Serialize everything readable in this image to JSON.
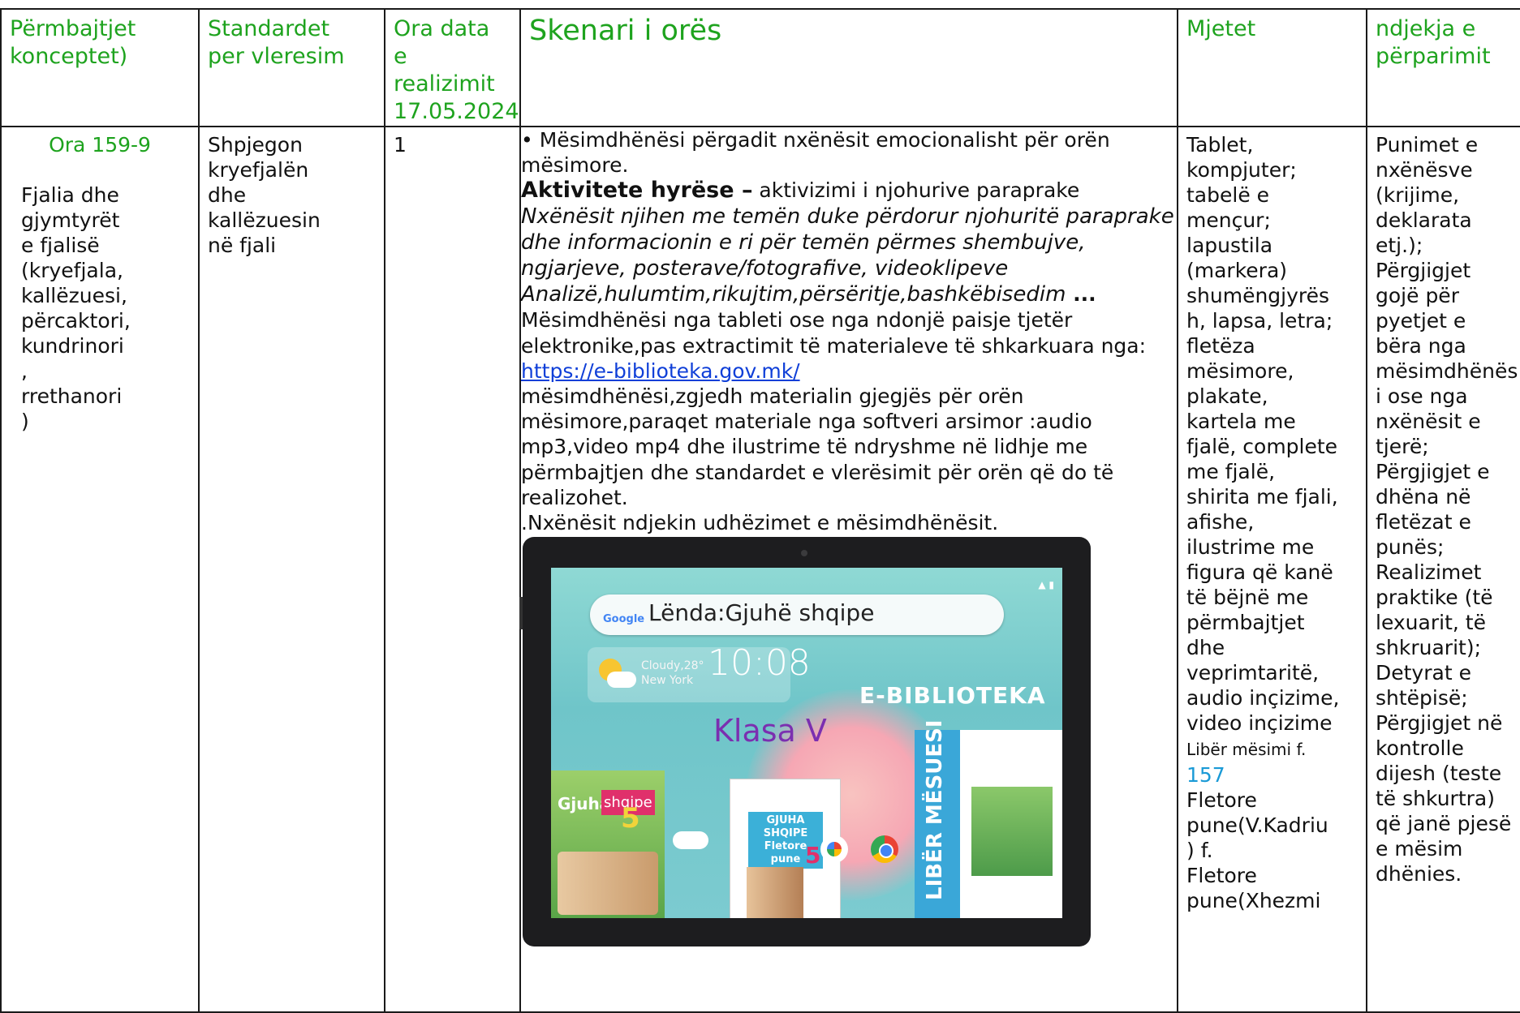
{
  "header": {
    "col1": [
      "Përmbajtjet",
      "konceptet)"
    ],
    "col2": [
      "Standardet",
      "per vleresim"
    ],
    "col3": [
      "Ora data e",
      "realizimit",
      "17.05.2024"
    ],
    "col4": "Skenari i orës",
    "col5": "Mjetet",
    "col6": [
      "ndjekja e",
      "përparimit"
    ]
  },
  "col1": {
    "topic": "Ora 159-9",
    "lines": [
      "Fjalia  dhe",
      "gjymtyrët",
      "e fjalisë",
      "(kryefjala,",
      "kallëzuesi,",
      "përcaktori,",
      "kundrinori",
      ",",
      "rrethanori",
      ")"
    ]
  },
  "col2": [
    "Shpjegon",
    "kryefjalën",
    "dhe",
    "kallëzuesin",
    "në fjali"
  ],
  "col3": "1",
  "col4": {
    "p1": "• Mësimdhënësi përgadit nxënësit emocionalisht për orën mësimore.",
    "bold": "Aktivitete hyrëse –",
    "after_bold": " aktivizimi i njohurive paraprake",
    "italic": "Nxënësit njihen me temën duke përdorur njohuritë paraprake dhe informacionin e ri për temën përmes shembujve, ngjarjeve, posterave/fotografive, videoklipeve Analizë,hulumtim,rikujtim,përsëritje,bashkëbisedim",
    "ellipsis": " ...",
    "p3": "Mësimdhënësi nga tableti ose nga ndonjë paisje tjetër elektronike,pas extractimit të materialeve të shkarkuara nga: ",
    "link": "https://e-biblioteka.gov.mk/",
    "p4": " mësimdhënësi,zgjedh materialin gjegjës për orën mësimore,paraqet materiale nga softveri arsimor :audio mp3,video mp4 dhe ilustrime të ndryshme në lidhje me përmbajtjen dhe standardet e vlerësimit për orën që do të realizohet.",
    "p5": ".Nxënësit ndjekin udhëzimet e mësimdhënësit."
  },
  "tablet": {
    "search_brand": "Google",
    "search_query": "Lënda:Gjuhë shqipe",
    "weather": [
      "Cloudy,28°",
      "New York"
    ],
    "clock": "10:08",
    "logo": "E-BIBLIOTEKA",
    "class_label": "Klasa V",
    "book1_a": "Gjuha",
    "book1_b": "shqipe",
    "book1_num": "5",
    "book2": "GJUHA SHQIPE Fletore pune",
    "book2_num": "5",
    "book3": "LIBËR MËSUESI"
  },
  "col5": {
    "lines": [
      "Tablet,",
      "kompjuter;",
      "tabelë e",
      "mençur;",
      "lapustila",
      "(markera)",
      "shumëngjyrës",
      "h, lapsa, letra;",
      "fletëza",
      "mësimore,",
      "plakate,",
      "kartela me",
      "fjalë, complete",
      "me fjalë,",
      "shirita me fjali,",
      "afishe,",
      "ilustrime me",
      "figura që kanë",
      "të bëjnë me",
      "përmbajtjet",
      "dhe",
      "veprimtaritë,",
      "audio inçizime,",
      "video inçizime"
    ],
    "small": "Libër mësimi f.",
    "page": "157",
    "lines2": [
      "Fletore",
      "pune(V.Kadriu",
      ") f.",
      "Fletore",
      "pune(Xhezmi"
    ]
  },
  "col6": [
    "Punimet e",
    "nxënësve",
    "(krijime,",
    "deklarata",
    "etj.);",
    "Përgjigjet",
    "gojë për",
    "pyetjet e",
    "bëra nga",
    "mësimdhënës",
    "i ose nga",
    "nxënësit e",
    "tjerë;",
    "Përgjigjet e",
    "dhëna në",
    "fletëzat e",
    "punës;",
    "Realizimet",
    "praktike (të",
    "lexuarit, të",
    "shkruarit);",
    "Detyrat e",
    "shtëpisë;",
    "Përgjigjet në",
    "kontrolle",
    "dijesh (teste",
    "të shkurtra)",
    "që janë pjesë",
    "e mësim",
    "dhënies."
  ]
}
